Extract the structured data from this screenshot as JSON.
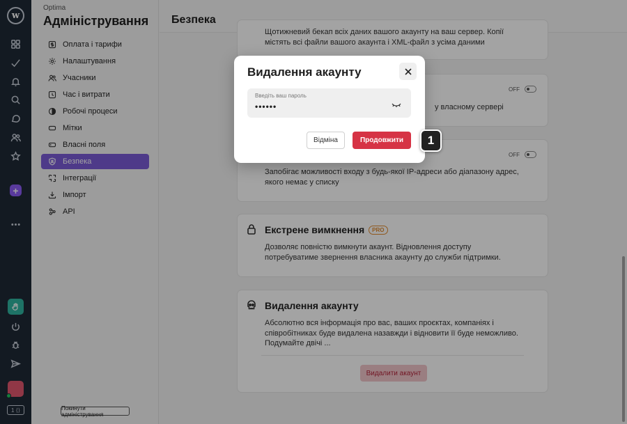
{
  "app": {
    "org_name": "Optima",
    "section_title": "Адміністрування",
    "logo_letter": "w",
    "kbd_hint": "1 ⟨⟩",
    "leave_admin_label": "Покинути адміністрування"
  },
  "sidebar": {
    "items": [
      {
        "label": "Оплата і тарифи",
        "icon": "dollar-icon"
      },
      {
        "label": "Налаштування",
        "icon": "gear-icon"
      },
      {
        "label": "Учасники",
        "icon": "users-icon"
      },
      {
        "label": "Час і витрати",
        "icon": "clock-icon"
      },
      {
        "label": "Робочі процеси",
        "icon": "workflow-icon"
      },
      {
        "label": "Мітки",
        "icon": "tag-icon"
      },
      {
        "label": "Власні поля",
        "icon": "field-icon"
      },
      {
        "label": "Безпека",
        "icon": "shield-icon",
        "active": true
      },
      {
        "label": "Інтеграції",
        "icon": "integration-icon"
      },
      {
        "label": "Імпорт",
        "icon": "import-icon"
      },
      {
        "label": "API",
        "icon": "api-icon"
      }
    ]
  },
  "main": {
    "title": "Безпека",
    "cards": {
      "backup": {
        "desc": "Щотижневий бекап всіх даних вашого акаунту на ваш сервер. Копії містять всі файли вашого акаунта і XML-файл з усіма даними"
      },
      "server": {
        "desc": "у власному сервері",
        "toggle": "OFF"
      },
      "ip": {
        "desc": "Запобігає можливості входу з будь-якої IP-адреси або діапазону адрес, якого немає у списку",
        "toggle": "OFF"
      },
      "shutdown": {
        "title": "Екстрене вимкнення",
        "badge": "PRO",
        "desc": "Дозволяє повністю вимкнути акаунт. Відновлення доступу потребуватиме звернення власника акаунту до служби підтримки."
      },
      "delete": {
        "title": "Видалення акаунту",
        "desc": "Абсолютно вся інформація про вас, ваших проєктах, компаніях і співробітниках буде видалена назавжди і відновити її буде неможливо. Подумайте двічі ...",
        "button": "Видалити акаунт"
      }
    }
  },
  "modal": {
    "title": "Видалення акаунту",
    "password_label": "Введіть ваш пароль",
    "password_value": "••••••",
    "cancel_label": "Відміна",
    "continue_label": "Продовжити"
  },
  "callout": {
    "number": "1"
  },
  "colors": {
    "accent": "#7b5bd6",
    "danger": "#d63345",
    "rail": "#1f2a36",
    "pro_badge": "#e08a2e"
  }
}
